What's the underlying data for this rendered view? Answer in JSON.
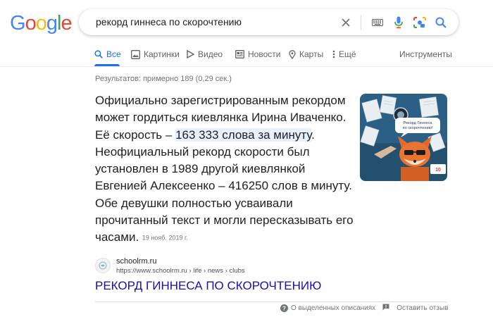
{
  "logo": {
    "letters": [
      "G",
      "o",
      "o",
      "g",
      "l",
      "e"
    ],
    "colors": [
      "#4285f4",
      "#ea4335",
      "#fbbc05",
      "#4285f4",
      "#34a853",
      "#ea4335"
    ]
  },
  "search": {
    "query": "рекорд гиннеса по скорочтению"
  },
  "tabs": [
    {
      "label": "Все",
      "icon": "search-icon",
      "active": true
    },
    {
      "label": "Картинки",
      "icon": "image-icon"
    },
    {
      "label": "Видео",
      "icon": "video-icon"
    },
    {
      "label": "Новости",
      "icon": "news-icon"
    },
    {
      "label": "Карты",
      "icon": "map-pin-icon"
    },
    {
      "label": "Ещё",
      "icon": "more-icon"
    }
  ],
  "tools_label": "Инструменты",
  "results_stats": "Результатов: примерно 189 (0,29 сек.)",
  "snippet": {
    "text_before": "Официально зарегистрированным рекордом может гордиться киевлянка Ирина Иваченко. Её скорость – ",
    "highlight": "163 333 слова за минуту",
    "text_after": ". Неофициальный рекорд скорости был установлен в 1989 другой киевлянкой Евгенией Алексеенко – 416250 слов в минуту. Обе девушки полностью усваивали прочитанный текст и могли пересказывать его часами.",
    "date": "19 нояб. 2019 г.",
    "image_caption": "Рекорд Гиннеса по скорочтению!"
  },
  "result": {
    "site_name": "schoolrm.ru",
    "url": "https://www.schoolrm.ru › life › news › clubs",
    "title": "РЕКОРД ГИННЕСА ПО СКОРОЧТЕНИЮ"
  },
  "footer": {
    "about_label": "О выделенных описаниях",
    "feedback_label": "Оставить отзыв"
  },
  "colors": {
    "link": "#1a0dab",
    "accent": "#1a73e8",
    "highlight": "#e8f0fe"
  }
}
